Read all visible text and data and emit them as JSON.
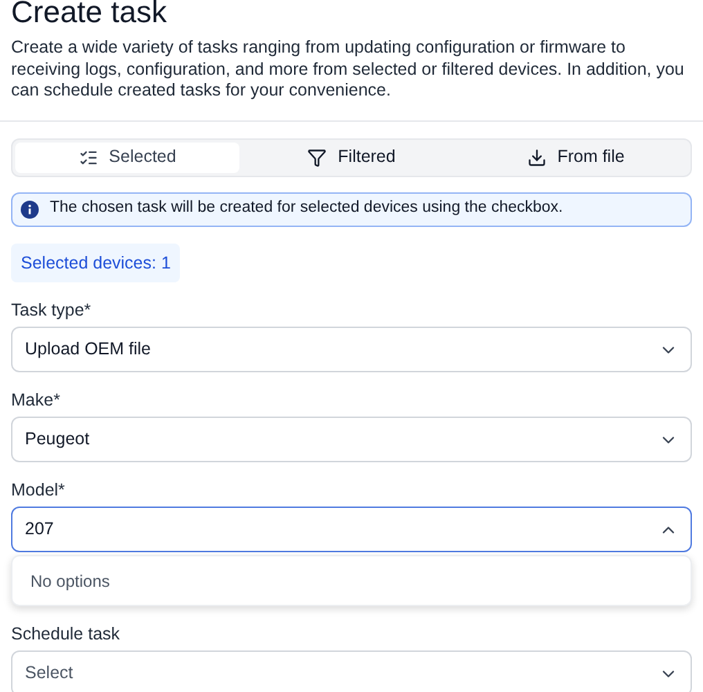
{
  "title": "Create task",
  "description": "Create a wide variety of tasks ranging from updating configuration or firmware to receiving logs, configuration, and more from selected or filtered devices. In addition, you can schedule created tasks for your convenience.",
  "tabs": [
    {
      "label": "Selected",
      "selected": true
    },
    {
      "label": "Filtered",
      "selected": false
    },
    {
      "label": "From file",
      "selected": false
    }
  ],
  "info": "The chosen task will be created for selected devices using the checkbox.",
  "selected_devices": "Selected devices: 1",
  "fields": [
    {
      "label": "Task type*",
      "value": "Upload OEM file",
      "expanded": false
    },
    {
      "label": "Make*",
      "value": "Peugeot",
      "expanded": false
    },
    {
      "label": "Model*",
      "value": "207",
      "expanded": true,
      "menu_message": "No options"
    },
    {
      "label": "Schedule task",
      "placeholder": "Select",
      "expanded": false
    }
  ]
}
